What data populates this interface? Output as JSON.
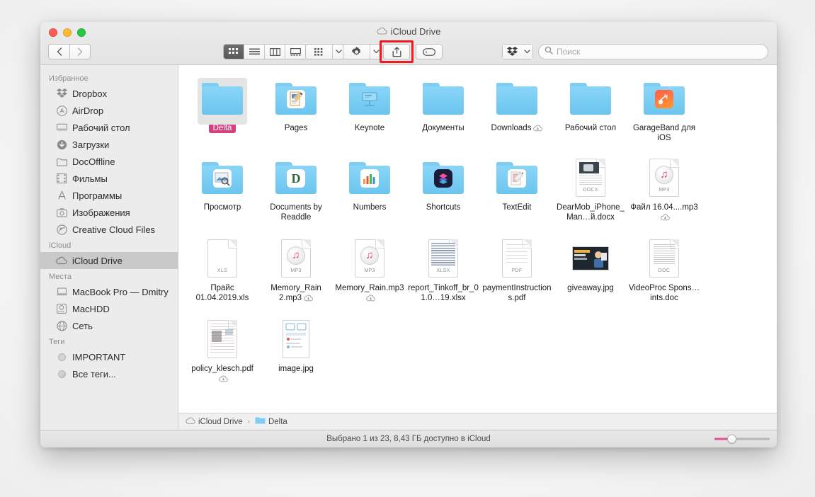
{
  "window": {
    "title": "iCloud Drive",
    "title_icon": "cloud-icon"
  },
  "toolbar": {
    "back_label": "‹",
    "forward_label": "›",
    "view_buttons": [
      {
        "name": "icon-view",
        "label": "Icon View",
        "active": true
      },
      {
        "name": "list-view",
        "label": "List View",
        "active": false
      },
      {
        "name": "column-view",
        "label": "Column View",
        "active": false
      },
      {
        "name": "gallery-view",
        "label": "Gallery View",
        "active": false
      }
    ],
    "arrange_label": "Arrange",
    "action_label": "Action",
    "share_label": "Share",
    "tag_label": "Tag",
    "dropbox_label": "Dropbox"
  },
  "search": {
    "placeholder": "Поиск",
    "value": ""
  },
  "sidebar": {
    "sections": [
      {
        "header": "Избранное",
        "items": [
          {
            "label": "Dropbox",
            "icon": "dropbox-icon",
            "selected": false
          },
          {
            "label": "AirDrop",
            "icon": "airdrop-icon",
            "selected": false
          },
          {
            "label": "Рабочий стол",
            "icon": "desktop-icon",
            "selected": false
          },
          {
            "label": "Загрузки",
            "icon": "downloads-icon",
            "selected": false
          },
          {
            "label": "DocOffline",
            "icon": "folder-icon",
            "selected": false
          },
          {
            "label": "Фильмы",
            "icon": "movies-icon",
            "selected": false
          },
          {
            "label": "Программы",
            "icon": "applications-icon",
            "selected": false
          },
          {
            "label": "Изображения",
            "icon": "pictures-icon",
            "selected": false
          },
          {
            "label": "Creative Cloud Files",
            "icon": "creative-cloud-icon",
            "selected": false
          }
        ]
      },
      {
        "header": "iCloud",
        "items": [
          {
            "label": "iCloud Drive",
            "icon": "cloud-icon",
            "selected": true
          }
        ]
      },
      {
        "header": "Места",
        "items": [
          {
            "label": "MacBook Pro — Dmitry",
            "icon": "laptop-icon",
            "selected": false
          },
          {
            "label": "MacHDD",
            "icon": "harddisk-icon",
            "selected": false
          },
          {
            "label": "Сеть",
            "icon": "network-icon",
            "selected": false
          }
        ]
      },
      {
        "header": "Теги",
        "items": [
          {
            "label": "IMPORTANT",
            "icon": "tag-dot-grey",
            "selected": false
          },
          {
            "label": "Все теги...",
            "icon": "tag-dot-multi",
            "selected": false
          }
        ]
      }
    ]
  },
  "files": [
    {
      "name": "Delta",
      "kind": "folder",
      "selected": true,
      "tagged": true,
      "cloud": false,
      "inner": "none"
    },
    {
      "name": "Pages",
      "kind": "folder",
      "selected": false,
      "tagged": false,
      "cloud": false,
      "inner": "pages"
    },
    {
      "name": "Keynote",
      "kind": "folder",
      "selected": false,
      "tagged": false,
      "cloud": false,
      "inner": "keynote"
    },
    {
      "name": "Документы",
      "kind": "folder",
      "selected": false,
      "tagged": false,
      "cloud": false,
      "inner": "none"
    },
    {
      "name": "Downloads",
      "kind": "folder",
      "selected": false,
      "tagged": false,
      "cloud": true,
      "inner": "none"
    },
    {
      "name": "Рабочий стол",
      "kind": "folder",
      "selected": false,
      "tagged": false,
      "cloud": false,
      "inner": "none"
    },
    {
      "name": "GarageBand для iOS",
      "kind": "folder",
      "selected": false,
      "tagged": false,
      "cloud": false,
      "inner": "garageband"
    },
    {
      "name": "Просмотр",
      "kind": "folder",
      "selected": false,
      "tagged": false,
      "cloud": false,
      "inner": "preview"
    },
    {
      "name": "Documents by Readdle",
      "kind": "folder",
      "selected": false,
      "tagged": false,
      "cloud": false,
      "inner": "documents"
    },
    {
      "name": "Numbers",
      "kind": "folder",
      "selected": false,
      "tagged": false,
      "cloud": false,
      "inner": "numbers"
    },
    {
      "name": "Shortcuts",
      "kind": "folder",
      "selected": false,
      "tagged": false,
      "cloud": false,
      "inner": "shortcuts"
    },
    {
      "name": "TextEdit",
      "kind": "folder",
      "selected": false,
      "tagged": false,
      "cloud": false,
      "inner": "textedit"
    },
    {
      "name": "DearMob_iPhone_Man…й.docx",
      "kind": "doc",
      "badge": "DOCX",
      "selected": false,
      "tagged": false,
      "cloud": false,
      "preview": "docx"
    },
    {
      "name": "Файл 16.04....mp3",
      "kind": "doc",
      "badge": "MP3",
      "selected": false,
      "tagged": false,
      "cloud": true,
      "preview": "mp3"
    },
    {
      "name": "Прайс 01.04.2019.xls",
      "kind": "doc",
      "badge": "XLS",
      "selected": false,
      "tagged": false,
      "cloud": false,
      "preview": "blank"
    },
    {
      "name": "Memory_Rain 2.mp3",
      "kind": "doc",
      "badge": "MP3",
      "selected": false,
      "tagged": false,
      "cloud": true,
      "preview": "mp3"
    },
    {
      "name": "Memory_Rain.mp3",
      "kind": "doc",
      "badge": "MP3",
      "selected": false,
      "tagged": false,
      "cloud": true,
      "preview": "mp3"
    },
    {
      "name": "report_Tinkoff_br_01.0…19.xlsx",
      "kind": "doc",
      "badge": "XLSX",
      "selected": false,
      "tagged": false,
      "cloud": false,
      "preview": "xlsx"
    },
    {
      "name": "paymentInstructions.pdf",
      "kind": "doc",
      "badge": "PDF",
      "selected": false,
      "tagged": false,
      "cloud": false,
      "preview": "pdf"
    },
    {
      "name": "giveaway.jpg",
      "kind": "image",
      "badge": "",
      "selected": false,
      "tagged": false,
      "cloud": false,
      "preview": "giveaway"
    },
    {
      "name": "VideoProc Spons…ints.doc",
      "kind": "doc",
      "badge": "DOC",
      "selected": false,
      "tagged": false,
      "cloud": false,
      "preview": "doc"
    },
    {
      "name": "policy_klesch.pdf",
      "kind": "doc",
      "badge": "",
      "selected": false,
      "tagged": false,
      "cloud": true,
      "preview": "policy"
    },
    {
      "name": "image.jpg",
      "kind": "image-tall",
      "badge": "",
      "selected": false,
      "tagged": false,
      "cloud": false,
      "preview": "image"
    }
  ],
  "pathbar": {
    "crumbs": [
      {
        "label": "iCloud Drive",
        "icon": "cloud-icon"
      },
      {
        "label": "Delta",
        "icon": "folder-icon"
      }
    ],
    "separator": "›"
  },
  "statusbar": {
    "text": "Выбрано 1 из 23, 8,43 ГБ доступно в iCloud",
    "zoom_label": "Icon size"
  },
  "colors": {
    "tag_pink": "#d6407f",
    "annotation_red": "#ee1b24",
    "folder_blue": "#6cc5f0",
    "slider_fill": "#e0509a"
  }
}
